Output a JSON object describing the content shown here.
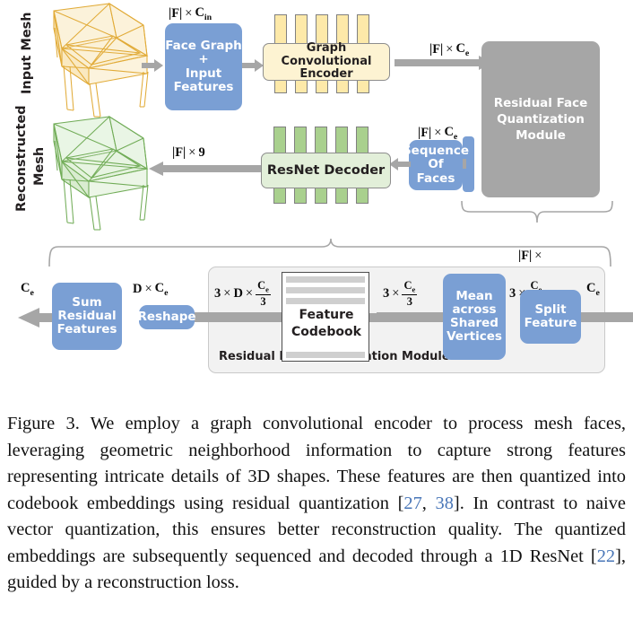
{
  "figure": {
    "number": "Figure 3.",
    "side_labels": {
      "input_mesh": "Input Mesh",
      "reconstructed_mesh": "Reconstructed\nMesh",
      "reconstructed_mesh_line1": "Reconstructed",
      "reconstructed_mesh_line2": "Mesh"
    },
    "blocks": {
      "face_graph": "Face Graph\n+\nInput\nFeatures",
      "face_graph_l1": "Face Graph",
      "face_graph_l2": "+",
      "face_graph_l3": "Input",
      "face_graph_l4": "Features",
      "graph_conv_encoder_l1": "Graph Convolutional",
      "graph_conv_encoder_l2": "Encoder",
      "rfq_module_l1": "Residual Face",
      "rfq_module_l2": "Quantization",
      "rfq_module_l3": "Module",
      "sequence_of_faces_l1": "Sequence",
      "sequence_of_faces_l2": "Of Faces",
      "resnet_decoder": "ResNet Decoder",
      "sum_residual_l1": "Sum",
      "sum_residual_l2": "Residual",
      "sum_residual_l3": "Features",
      "reshape": "Reshape",
      "feature_codebook_l1": "Feature",
      "feature_codebook_l2": "Codebook",
      "mean_shared_l1": "Mean",
      "mean_shared_l2": "across",
      "mean_shared_l3": "Shared",
      "mean_shared_l4": "Vertices",
      "split_feature_l1": "Split",
      "split_feature_l2": "Feature",
      "panel_title": "Residual Face Quantization Module"
    },
    "edge_labels": {
      "f_x_cin_f": "|F|",
      "f_x_cin_times": "×",
      "f_x_cin_c": "C",
      "f_x_cin_sub": "in",
      "f_x_ce_c": "C",
      "f_x_ce_sub": "e",
      "f_x_9": "9",
      "times": "×",
      "three": "3",
      "d": "D",
      "ce": "C",
      "ce_sub": "e",
      "frac_den": "3",
      "bracket_label_f": "|F|",
      "bracket_label_times": "×"
    },
    "colors": {
      "blue": "#7a9fd4",
      "cream": "#fdf3d2",
      "mint": "#e2efd9",
      "grey": "#a6a6a6",
      "panel": "#f2f2f2",
      "mesh_input": "#e8b84b",
      "mesh_recon": "#6aa84f",
      "reference_link": "#4a77b8"
    }
  },
  "caption": {
    "segments": [
      {
        "t": "Figure 3.  We employ a graph convolutional encoder to process mesh faces, leveraging geometric neighborhood information to capture strong features representing intricate details of 3D shapes. These features are then quantized into codebook embeddings using residual quantization [",
        "ref": false
      },
      {
        "t": "27",
        "ref": true
      },
      {
        "t": ", ",
        "ref": false
      },
      {
        "t": "38",
        "ref": true
      },
      {
        "t": "]. In contrast to naive vector quantization, this ensures better reconstruction quality. The quantized embeddings are subsequently sequenced and decoded through a 1D ResNet [",
        "ref": false
      },
      {
        "t": "22",
        "ref": true
      },
      {
        "t": "], guided by a reconstruction loss.",
        "ref": false
      }
    ]
  }
}
